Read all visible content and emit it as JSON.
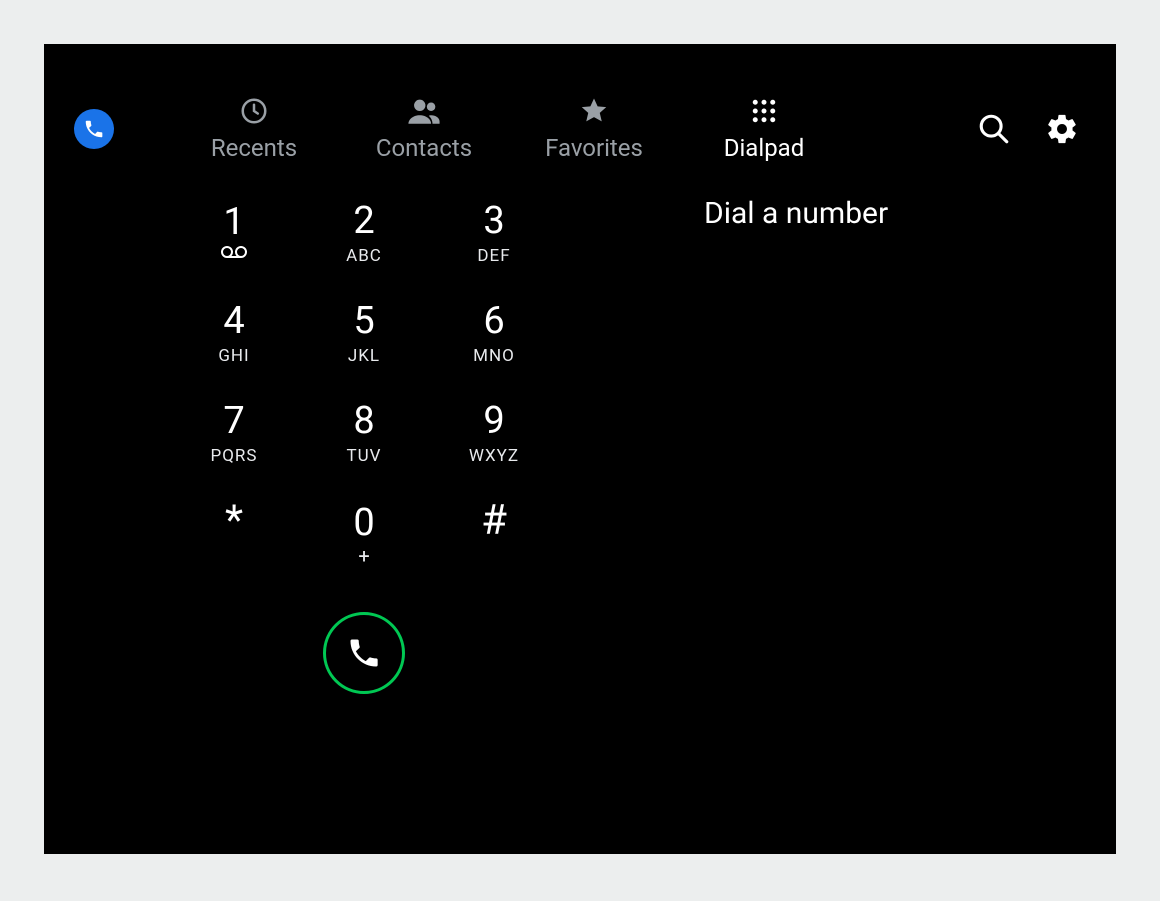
{
  "tabs": {
    "recents": "Recents",
    "contacts": "Contacts",
    "favorites": "Favorites",
    "dialpad": "Dialpad"
  },
  "dialpad": {
    "placeholder": "Dial a number",
    "keys": {
      "k1": {
        "d": "1",
        "s": "voicemail"
      },
      "k2": {
        "d": "2",
        "s": "ABC"
      },
      "k3": {
        "d": "3",
        "s": "DEF"
      },
      "k4": {
        "d": "4",
        "s": "GHI"
      },
      "k5": {
        "d": "5",
        "s": "JKL"
      },
      "k6": {
        "d": "6",
        "s": "MNO"
      },
      "k7": {
        "d": "7",
        "s": "PQRS"
      },
      "k8": {
        "d": "8",
        "s": "TUV"
      },
      "k9": {
        "d": "9",
        "s": "WXYZ"
      },
      "kstar": {
        "d": "*"
      },
      "k0": {
        "d": "0",
        "s": "+"
      },
      "khash": {
        "d": "#"
      }
    }
  }
}
